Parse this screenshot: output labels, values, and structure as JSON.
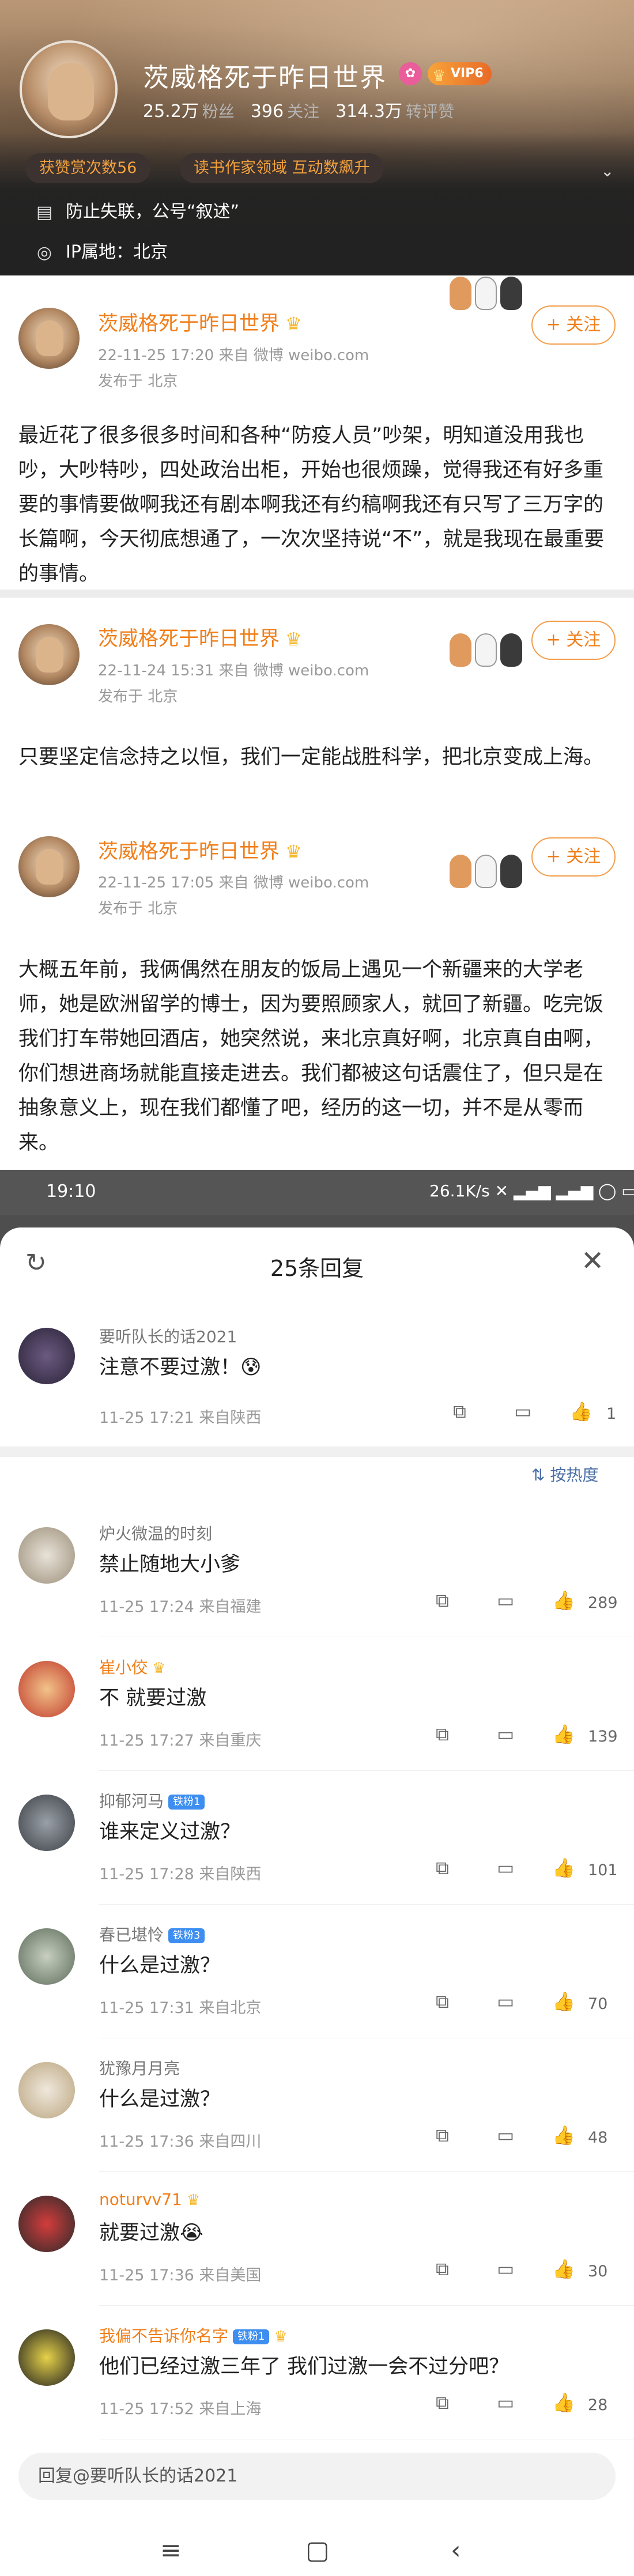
{
  "profile": {
    "name": "茨威格死于昨日世界",
    "vip_label": "VIP6",
    "stats": [
      {
        "value": "25.2万",
        "label": "粉丝"
      },
      {
        "value": "396",
        "label": "关注"
      },
      {
        "value": "314.3万",
        "label": "转评赞"
      }
    ],
    "tags": [
      "获赞赏次数56",
      "读书作家领域 互动数飙升"
    ],
    "bio": "防止失联，公号“叙述”",
    "ip": "IP属地：北京"
  },
  "posts": [
    {
      "author": "茨威格死于昨日世界",
      "meta": "22-11-25 17:20  来自 微博 weibo.com",
      "location": "发布于 北京",
      "follow_label": "+ 关注",
      "text": "最近花了很多很多时间和各种“防疫人员”吵架，明知道没用我也吵，大吵特吵，四处政治出柜，开始也很烦躁，觉得我还有好多重要的事情要做啊我还有剧本啊我还有约稿啊我还有只写了三万字的长篇啊，今天彻底想通了，一次次坚持说“不”，就是我现在最重要的事情。"
    },
    {
      "author": "茨威格死于昨日世界",
      "meta": "22-11-24 15:31  来自 微博 weibo.com",
      "location": "发布于 北京",
      "follow_label": "+ 关注",
      "text": "只要坚定信念持之以恒，我们一定能战胜科学，把北京变成上海。"
    },
    {
      "author": "茨威格死于昨日世界",
      "meta": "22-11-25 17:05  来自 微博 weibo.com",
      "location": "发布于 北京",
      "follow_label": "+ 关注",
      "text": "大概五年前，我俩偶然在朋友的饭局上遇见一个新疆来的大学老师，她是欧洲留学的博士，因为要照顾家人，就回了新疆。吃完饭我们打车带她回酒店，她突然说，来北京真好啊，北京真自由啊，你们想进商场就能直接走进去。我们都被这句话震住了，但只是在抽象意义上，现在我们都懂了吧，经历的这一切，并不是从零而来。"
    }
  ],
  "status_bar": {
    "time": "19:10",
    "right": "26.1K/s"
  },
  "sheet": {
    "title": "25条回复",
    "sort_label": "按热度",
    "reply_placeholder": "回复@要听队长的话2021",
    "top_comment": {
      "name": "要听队长的话2021",
      "text": "注意不要过激！😰",
      "meta": "11-25 17:21  来自陕西",
      "likes": "1"
    },
    "comments": [
      {
        "name": "炉火微温的时刻",
        "text": "禁止随地大小爹",
        "meta": "11-25 17:24  来自福建",
        "likes": "289"
      },
      {
        "name": "崔小佼",
        "text": "不 就要过激",
        "meta": "11-25 17:27  来自重庆",
        "likes": "139"
      },
      {
        "name": "抑郁河马",
        "badge": "铁粉1",
        "text": "谁来定义过激？",
        "meta": "11-25 17:28  来自陕西",
        "likes": "101"
      },
      {
        "name": "春已堪怜",
        "badge": "铁粉3",
        "text": "什么是过激？",
        "meta": "11-25 17:31  来自北京",
        "likes": "70"
      },
      {
        "name": "犹豫月月亮",
        "text": "什么是过激？",
        "meta": "11-25 17:36  来自四川",
        "likes": "48"
      },
      {
        "name": "noturvv71",
        "text": "就要过激😭",
        "meta": "11-25 17:36  来自美国",
        "likes": "30"
      },
      {
        "name": "我偏不告诉你名字",
        "badge": "铁粉1",
        "text": "他们已经过激三年了 我们过激一会不过分吧？",
        "meta": "11-25 17:52  来自上海",
        "likes": "28"
      }
    ]
  },
  "colors": {
    "accent": "#f07f1a",
    "link": "#4a6fa6",
    "vip": "#f7a43a"
  }
}
